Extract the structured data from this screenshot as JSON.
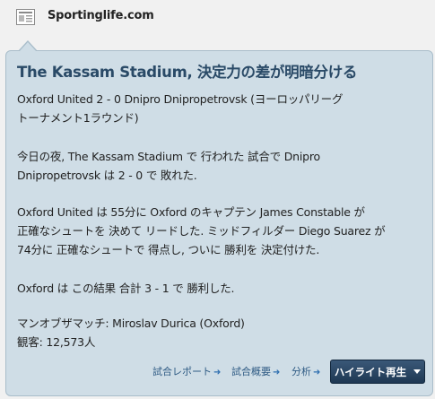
{
  "source": {
    "name": "Sportinglife.com",
    "icon": "newspaper-icon"
  },
  "article": {
    "headline": "The Kassam Stadium, 決定力の差が明暗分ける",
    "paragraphs": [
      [
        "Oxford United 2 - 0 Dnipro Dnipropetrovsk (ヨーロッパリーグ",
        "トーナメント1ラウンド)"
      ],
      [
        "今日の夜, The Kassam Stadium で 行われた 試合で Dnipro",
        "Dnipropetrovsk は 2 - 0 で 敗れた."
      ],
      [
        "Oxford United は 55分に Oxford のキャプテン James Constable が",
        "正確なシュートを 決めて リードした. ミッドフィルダー Diego Suarez が",
        "74分に 正確なシュートで 得点し, ついに 勝利を 決定付けた."
      ],
      [
        "Oxford は この結果 合計 3 - 1 で 勝利した."
      ],
      [
        "マンオブザマッチ: Miroslav Durica (Oxford)",
        "観客: 12,573人"
      ]
    ]
  },
  "actions": {
    "match_report": "試合レポート",
    "match_overview": "試合概要",
    "analysis": "分析",
    "highlights_button": "ハイライト再生",
    "link_arrow": "➜"
  }
}
